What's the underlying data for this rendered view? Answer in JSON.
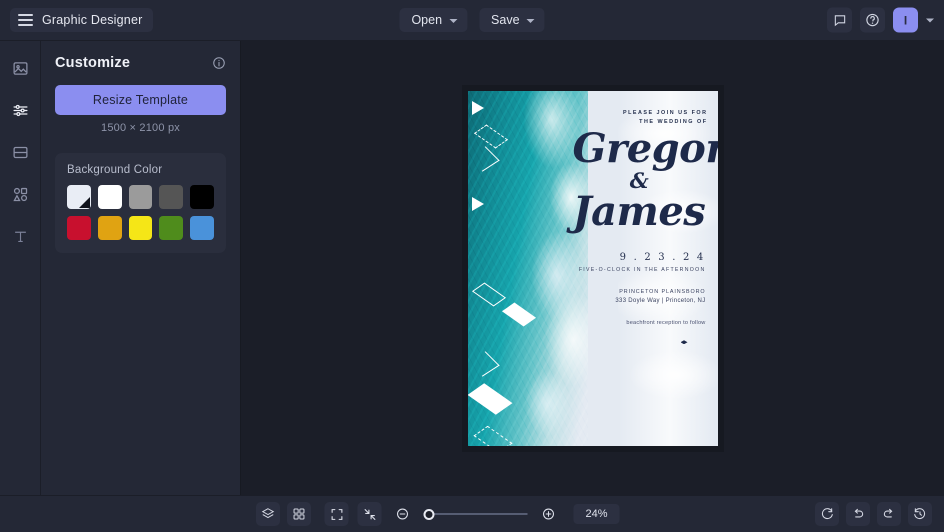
{
  "topbar": {
    "menu_icon": "hamburger-icon",
    "app_title": "Graphic Designer",
    "open_label": "Open",
    "save_label": "Save",
    "comment_icon": "comment-icon",
    "help_icon": "help-icon",
    "avatar_initial": "I",
    "avatar_chevron": "chevron-down-icon"
  },
  "rail": {
    "items": [
      {
        "icon": "image-icon",
        "name": "photos",
        "active": false
      },
      {
        "icon": "sliders-icon",
        "name": "customize",
        "active": true
      },
      {
        "icon": "layout-icon",
        "name": "templates",
        "active": false
      },
      {
        "icon": "shapes-icon",
        "name": "elements",
        "active": false
      },
      {
        "icon": "text-icon",
        "name": "text",
        "active": false
      }
    ]
  },
  "panel": {
    "title": "Customize",
    "info_icon": "info-icon",
    "resize_label": "Resize Template",
    "dimensions": "1500 × 2100 px",
    "background": {
      "label": "Background Color",
      "swatches": [
        {
          "name": "none",
          "color": "#e9edf5"
        },
        {
          "name": "white",
          "color": "#ffffff"
        },
        {
          "name": "gray",
          "color": "#9b9b9b"
        },
        {
          "name": "dark-gray",
          "color": "#555555"
        },
        {
          "name": "black",
          "color": "#000000"
        },
        {
          "name": "crimson",
          "color": "#c8102e"
        },
        {
          "name": "amber",
          "color": "#e0a312"
        },
        {
          "name": "yellow",
          "color": "#f5e617"
        },
        {
          "name": "green",
          "color": "#4f8c1c"
        },
        {
          "name": "blue",
          "color": "#4a92da"
        }
      ]
    }
  },
  "canvas": {
    "invitation": {
      "join_line1": "PLEASE JOIN US FOR",
      "join_line2": "THE WEDDING OF",
      "name1": "Gregory",
      "ampersand": "&",
      "name2": "James",
      "date": "9 . 2 3 . 2 4",
      "time": "FIVE-O-CLOCK IN THE AFTERNOON",
      "venue": "PRINCETON PLAINSBORO",
      "address": "333  Doyle Way | Princeton, NJ",
      "note": "beachfront reception to follow",
      "ornament": "diamond-icon"
    }
  },
  "bottombar": {
    "layers_icon": "layers-icon",
    "pages_icon": "grid-pages-icon",
    "fit_icon": "fit-screen-icon",
    "collapse_icon": "collapse-icon",
    "zoom_out_icon": "zoom-out-icon",
    "zoom_in_icon": "zoom-in-icon",
    "zoom_value": "24%",
    "reset_icon": "refresh-icon",
    "undo_icon": "undo-icon",
    "redo_icon": "redo-icon",
    "history_icon": "history-icon"
  },
  "colors": {
    "accent": "#8b8ef0",
    "chrome": "#242836",
    "workspace": "#1b1e28"
  }
}
